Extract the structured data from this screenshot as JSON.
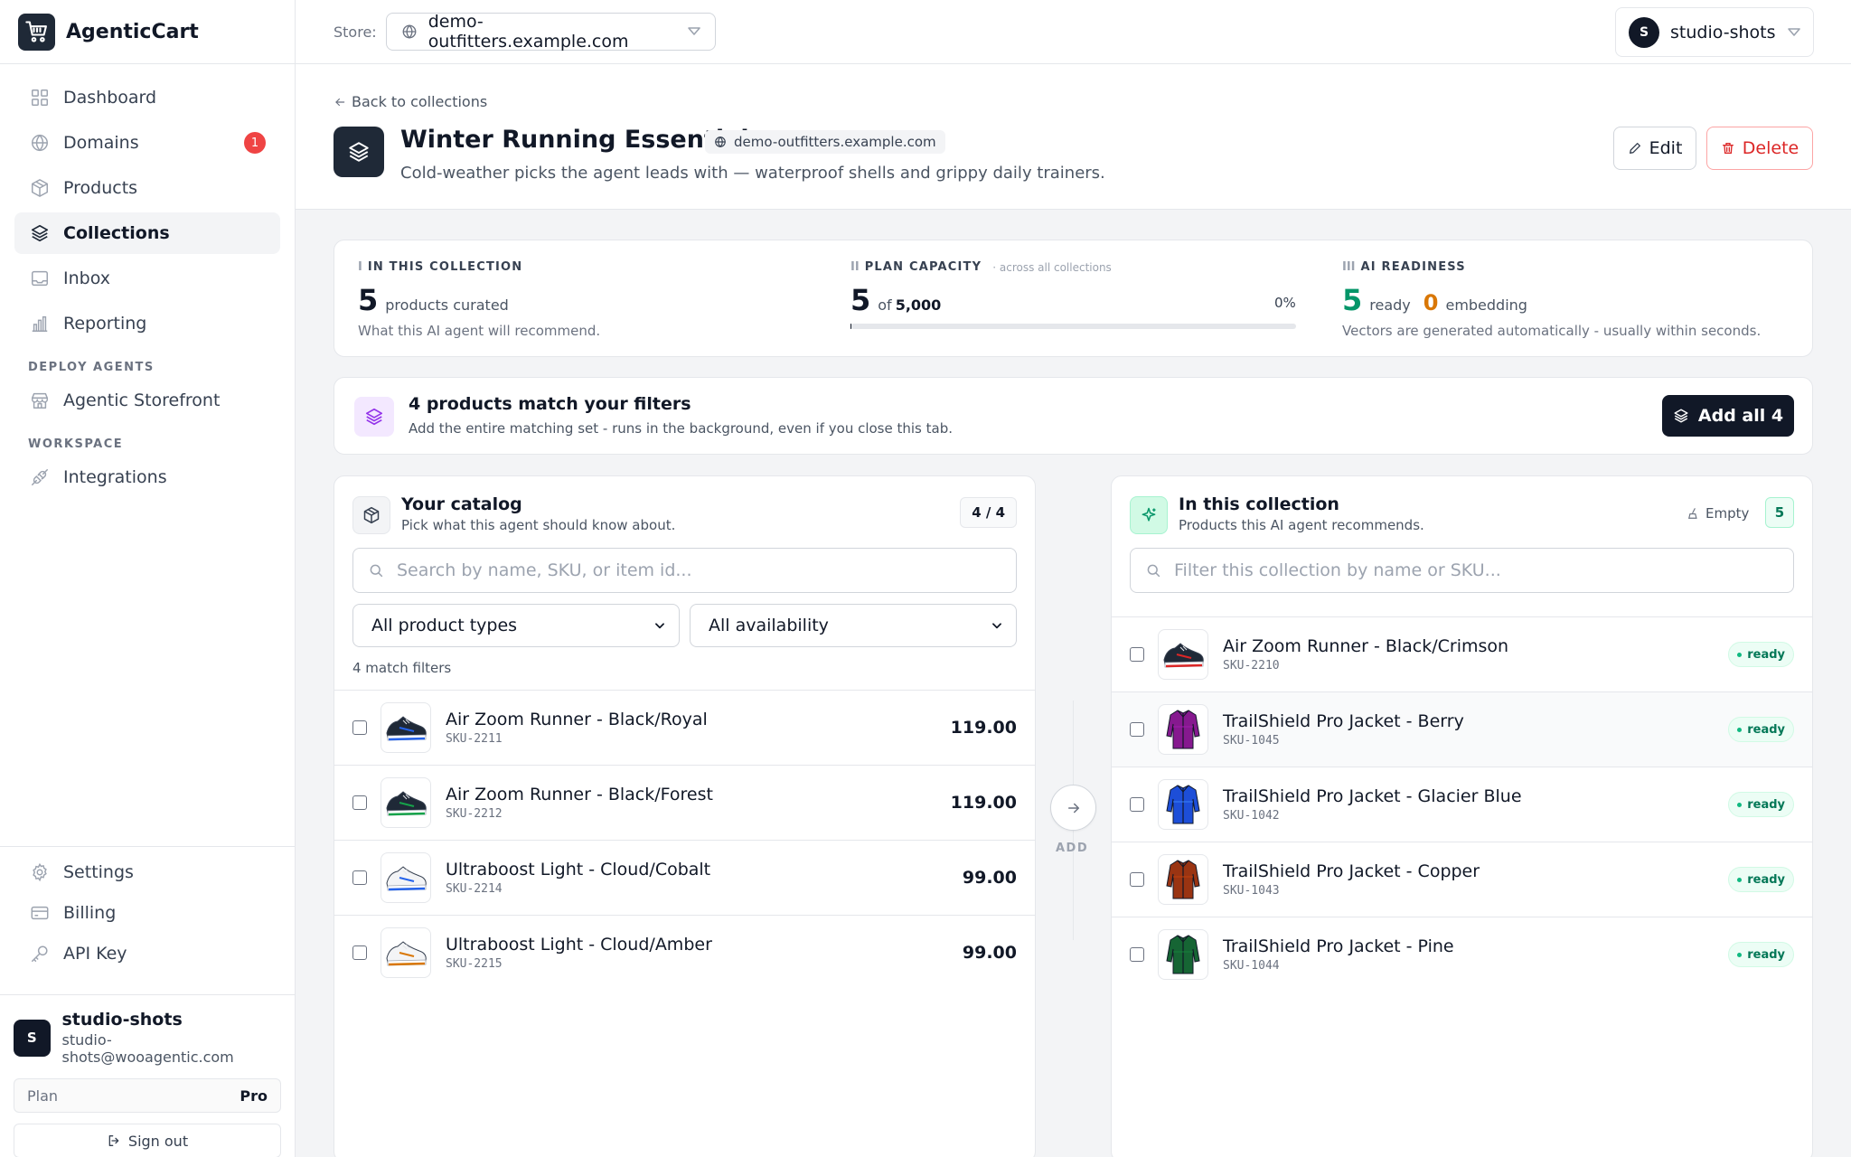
{
  "app": {
    "name": "AgenticCart"
  },
  "sidebar": {
    "items": [
      {
        "label": "Dashboard",
        "icon": "grid-icon"
      },
      {
        "label": "Domains",
        "icon": "globe-icon",
        "badge": "1"
      },
      {
        "label": "Products",
        "icon": "box-icon"
      },
      {
        "label": "Collections",
        "icon": "layers-icon",
        "active": true
      },
      {
        "label": "Inbox",
        "icon": "inbox-icon"
      },
      {
        "label": "Reporting",
        "icon": "bar-chart-icon"
      }
    ],
    "deploy_section": "DEPLOY AGENTS",
    "deploy_items": [
      {
        "label": "Agentic Storefront",
        "icon": "storefront-icon"
      }
    ],
    "workspace_section": "WORKSPACE",
    "workspace_items": [
      {
        "label": "Integrations",
        "icon": "plug-icon"
      }
    ],
    "bottom_items": [
      {
        "label": "Settings",
        "icon": "gear-icon"
      },
      {
        "label": "Billing",
        "icon": "credit-card-icon"
      },
      {
        "label": "API Key",
        "icon": "key-icon"
      }
    ],
    "user": {
      "initial": "S",
      "name": "studio-shots",
      "email": "studio-shots@wooagentic.com",
      "plan_label": "Plan",
      "plan_value": "Pro",
      "sign_out": "Sign out"
    }
  },
  "topbar": {
    "store_label": "Store:",
    "store_value": "demo-outfitters.example.com",
    "account_initial": "S",
    "account_name": "studio-shots"
  },
  "header": {
    "back_link": "Back to collections",
    "title": "Winter Running Essentials",
    "domain": "demo-outfitters.example.com",
    "description": "Cold-weather picks the agent leads with — waterproof shells and grippy daily trainers.",
    "edit_label": "Edit",
    "delete_label": "Delete"
  },
  "stats": {
    "collection": {
      "roman": "I",
      "label": "IN THIS COLLECTION",
      "value": "5",
      "unit": "products curated",
      "note": "What this AI agent will recommend."
    },
    "capacity": {
      "roman": "II",
      "label": "PLAN CAPACITY",
      "sublabel": "· across all collections",
      "value": "5",
      "of_text": "of",
      "limit": "5,000",
      "percent": "0%",
      "fill_fraction": 0.001
    },
    "readiness": {
      "roman": "III",
      "label": "AI READINESS",
      "ready_value": "5",
      "ready_label": "ready",
      "embedding_value": "0",
      "embedding_label": "embedding",
      "note": "Vectors are generated automatically - usually within seconds."
    }
  },
  "banner": {
    "title": "4 products match your filters",
    "subtitle": "Add the entire matching set - runs in the background, even if you close this tab.",
    "button": "Add all 4"
  },
  "catalog": {
    "title": "Your catalog",
    "subtitle": "Pick what this agent should know about.",
    "count": "4 / 4",
    "search_placeholder": "Search by name, SKU, or item id...",
    "type_filter": "All product types",
    "availability_filter": "All availability",
    "match_text": "4 match filters",
    "products": [
      {
        "name": "Air Zoom Runner - Black/Royal",
        "sku": "SKU-2211",
        "price": "119.00",
        "kind": "shoe",
        "color": "#1f2937",
        "accent": "#2563eb"
      },
      {
        "name": "Air Zoom Runner - Black/Forest",
        "sku": "SKU-2212",
        "price": "119.00",
        "kind": "shoe",
        "color": "#1f2937",
        "accent": "#16a34a"
      },
      {
        "name": "Ultraboost Light - Cloud/Cobalt",
        "sku": "SKU-2214",
        "price": "99.00",
        "kind": "shoe",
        "color": "#f3f4f6",
        "accent": "#2563eb"
      },
      {
        "name": "Ultraboost Light - Cloud/Amber",
        "sku": "SKU-2215",
        "price": "99.00",
        "kind": "shoe",
        "color": "#f3f4f6",
        "accent": "#d97706"
      }
    ]
  },
  "collection": {
    "title": "In this collection",
    "subtitle": "Products this AI agent recommends.",
    "empty_label": "Empty",
    "count": "5",
    "search_placeholder": "Filter this collection by name or SKU...",
    "products": [
      {
        "name": "Air Zoom Runner - Black/Crimson",
        "sku": "SKU-2210",
        "status": "ready",
        "kind": "shoe",
        "color": "#1f2937",
        "accent": "#dc2626"
      },
      {
        "name": "TrailShield Pro Jacket - Berry",
        "sku": "SKU-1045",
        "status": "ready",
        "kind": "jacket",
        "color": "#86198f",
        "accent": "#a21caf"
      },
      {
        "name": "TrailShield Pro Jacket - Glacier Blue",
        "sku": "SKU-1042",
        "status": "ready",
        "kind": "jacket",
        "color": "#1d4ed8",
        "accent": "#3b82f6"
      },
      {
        "name": "TrailShield Pro Jacket - Copper",
        "sku": "SKU-1043",
        "status": "ready",
        "kind": "jacket",
        "color": "#9a3412",
        "accent": "#c2410c"
      },
      {
        "name": "TrailShield Pro Jacket - Pine",
        "sku": "SKU-1044",
        "status": "ready",
        "kind": "jacket",
        "color": "#166534",
        "accent": "#15803d"
      }
    ]
  },
  "transfer": {
    "label": "ADD"
  }
}
